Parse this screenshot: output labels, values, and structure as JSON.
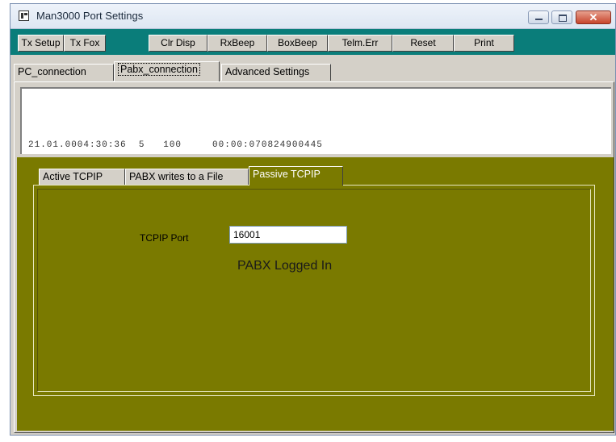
{
  "window": {
    "title": "Man3000 Port Settings"
  },
  "toolbar": {
    "buttons": [
      "Tx Setup",
      "Tx Fox",
      "Clr Disp",
      "RxBeep",
      "BoxBeep",
      "Telm.Err",
      "Reset",
      "Print"
    ]
  },
  "tabs": [
    "PC_connection",
    "Pabx_connection",
    "Advanced Settings"
  ],
  "log": {
    "line": "21.01.0004:30:36  5   100     00:00:070824900445"
  },
  "subtabs": [
    "Active TCPIP",
    "PABX writes to a File",
    "Passive TCPIP"
  ],
  "passive": {
    "port_label": "TCPIP Port",
    "port_value": "16001",
    "status": "PABX Logged In"
  },
  "colors": {
    "toolbar_bg": "#0a7d7a",
    "panel_bg": "#7a7a00"
  }
}
